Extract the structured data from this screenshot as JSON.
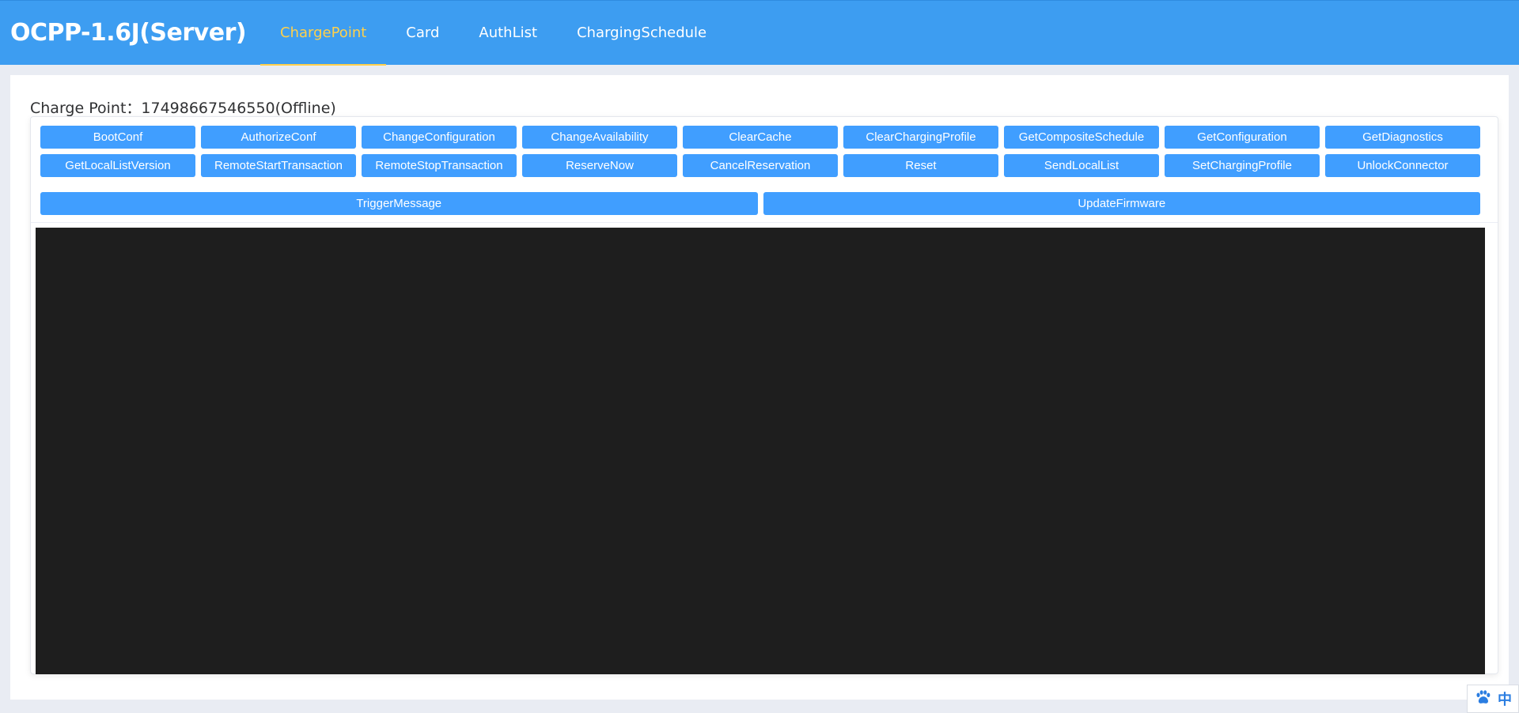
{
  "header": {
    "brand": "OCPP-1.6J(Server)",
    "tabs": [
      {
        "label": "ChargePoint",
        "active": true
      },
      {
        "label": "Card",
        "active": false
      },
      {
        "label": "AuthList",
        "active": false
      },
      {
        "label": "ChargingSchedule",
        "active": false
      }
    ],
    "active_color": "#ffd04b",
    "background_color": "#3d9df1"
  },
  "main": {
    "charge_point_label": "Charge Point：17498667546550(Offline)",
    "buttons_row1": [
      "BootConf",
      "AuthorizeConf",
      "ChangeConfiguration",
      "ChangeAvailability",
      "ClearCache",
      "ClearChargingProfile",
      "GetCompositeSchedule",
      "GetConfiguration",
      "GetDiagnostics"
    ],
    "buttons_row2": [
      "GetLocalListVersion",
      "RemoteStartTransaction",
      "RemoteStopTransaction",
      "ReserveNow",
      "CancelReservation",
      "Reset",
      "SendLocalList",
      "SetChargingProfile",
      "UnlockConnector"
    ],
    "buttons_row3": [
      "TriggerMessage",
      "UpdateFirmware"
    ],
    "button_color": "#409eff",
    "console_color": "#1e1e1e"
  },
  "ime": {
    "icon": "paw-icon",
    "lang": "中"
  }
}
